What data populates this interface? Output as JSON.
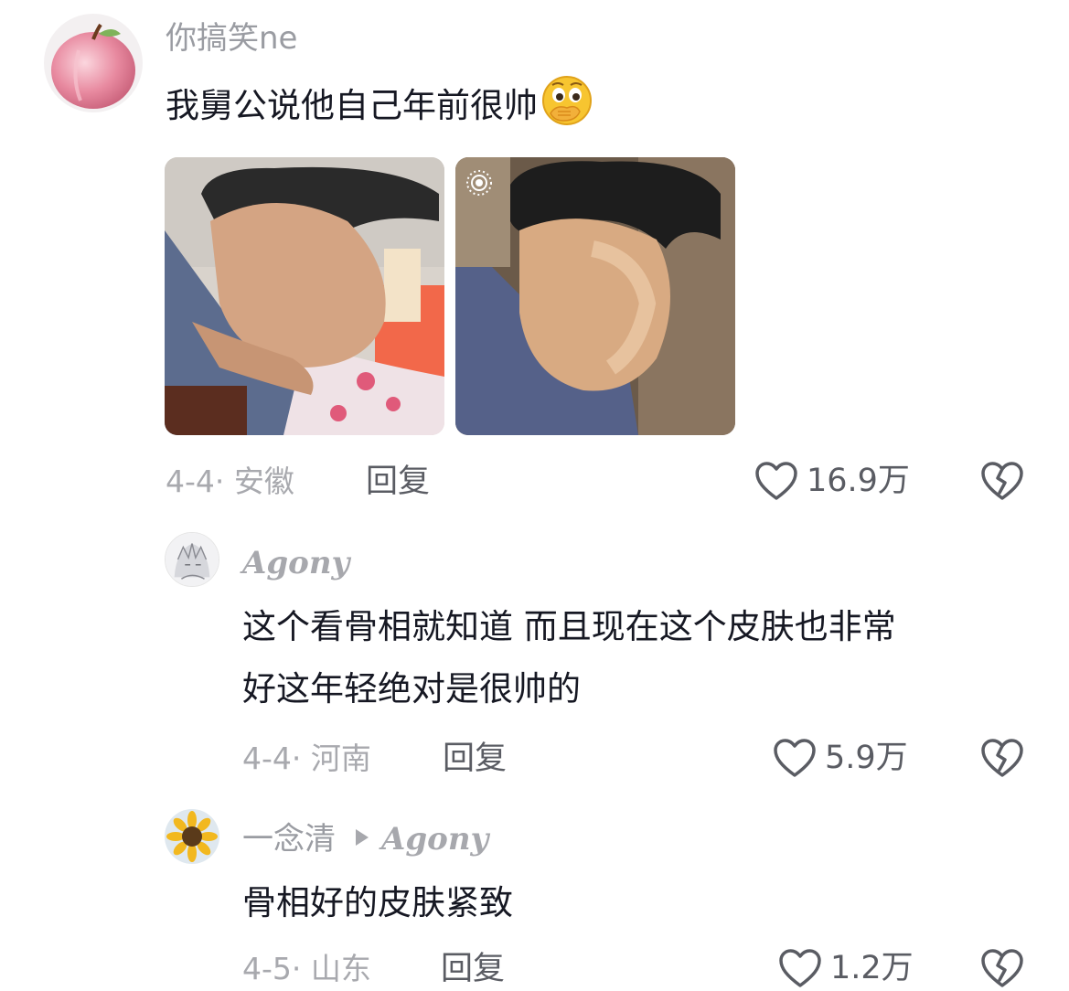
{
  "comments": [
    {
      "username": "你搞笑ne",
      "text": "我舅公说他自己年前很帅",
      "emoji": "face-with-hand-over-mouth-emoji",
      "date": "4-4",
      "location": "安徽",
      "date_sep": "· ",
      "reply_label": "回复",
      "like_count": "16.9万",
      "photos": [
        "man-leaning-over-table-photo",
        "man-in-sunlight-live-photo"
      ]
    },
    {
      "username": "Agony",
      "text_line1": "这个看骨相就知道 而且现在这个皮肤也非常",
      "text_line2": "好这年轻绝对是很帅的",
      "date": "4-4",
      "location": "河南",
      "date_sep": "· ",
      "reply_label": "回复",
      "like_count": "5.9万"
    },
    {
      "username": "一念清",
      "reply_to": "Agony",
      "text": "骨相好的皮肤紧致",
      "date": "4-5",
      "location": "山东",
      "date_sep": "· ",
      "reply_label": "回复",
      "like_count": "1.2万"
    }
  ],
  "icons": {
    "like": "heart-outline-icon",
    "dislike": "broken-heart-icon",
    "live": "live-photo-icon"
  },
  "colors": {
    "text": "#161823",
    "secondary": "#a8a9ae",
    "action": "#5a5c63"
  }
}
